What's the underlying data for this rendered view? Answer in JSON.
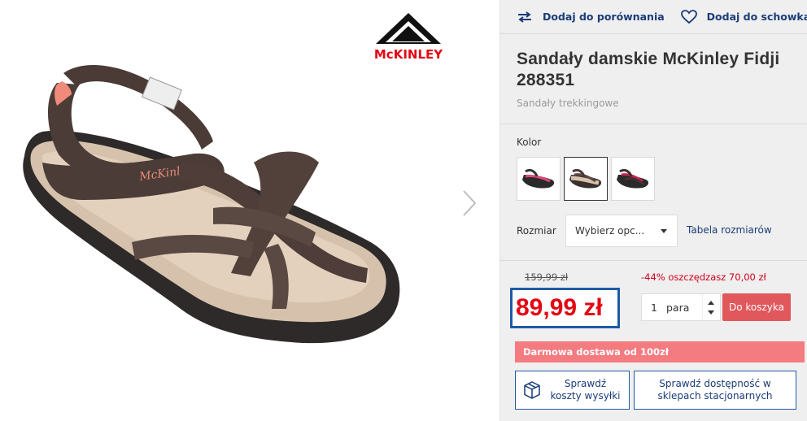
{
  "brand": {
    "logo_text": "McKINLEY"
  },
  "actions": {
    "compare_label": "Dodaj do porównania",
    "wishlist_label": "Dodaj do schowka"
  },
  "product": {
    "title": "Sandały damskie McKinley Fidji 288351",
    "category": "Sandały trekkingowe"
  },
  "color": {
    "label": "Kolor",
    "options": [
      "black-pink",
      "brown-beige",
      "dark-pink"
    ],
    "selected_index": 1
  },
  "size": {
    "label": "Rozmiar",
    "select_value": "Wybierz opc...",
    "size_table_link": "Tabela rozmiarów"
  },
  "pricing": {
    "old_price": "159,99 zł",
    "discount_text": "-44% oszczędzasz 70,00 zł",
    "price": "89,99 zł"
  },
  "quantity": {
    "value": "1",
    "unit": "para"
  },
  "cart": {
    "button_label": "Do koszyka"
  },
  "shipping_banner": "Darmowa dostawa od 100zł",
  "info_buttons": {
    "shipping_cost": "Sprawdź koszty wysyłki",
    "store_availability": "Sprawdź dostępność w sklepach stacjonarnych"
  },
  "colors": {
    "link_blue": "#1a3c78",
    "price_red": "#e30613",
    "cart_red": "#e0575c",
    "banner_pink": "#f47b7f"
  }
}
